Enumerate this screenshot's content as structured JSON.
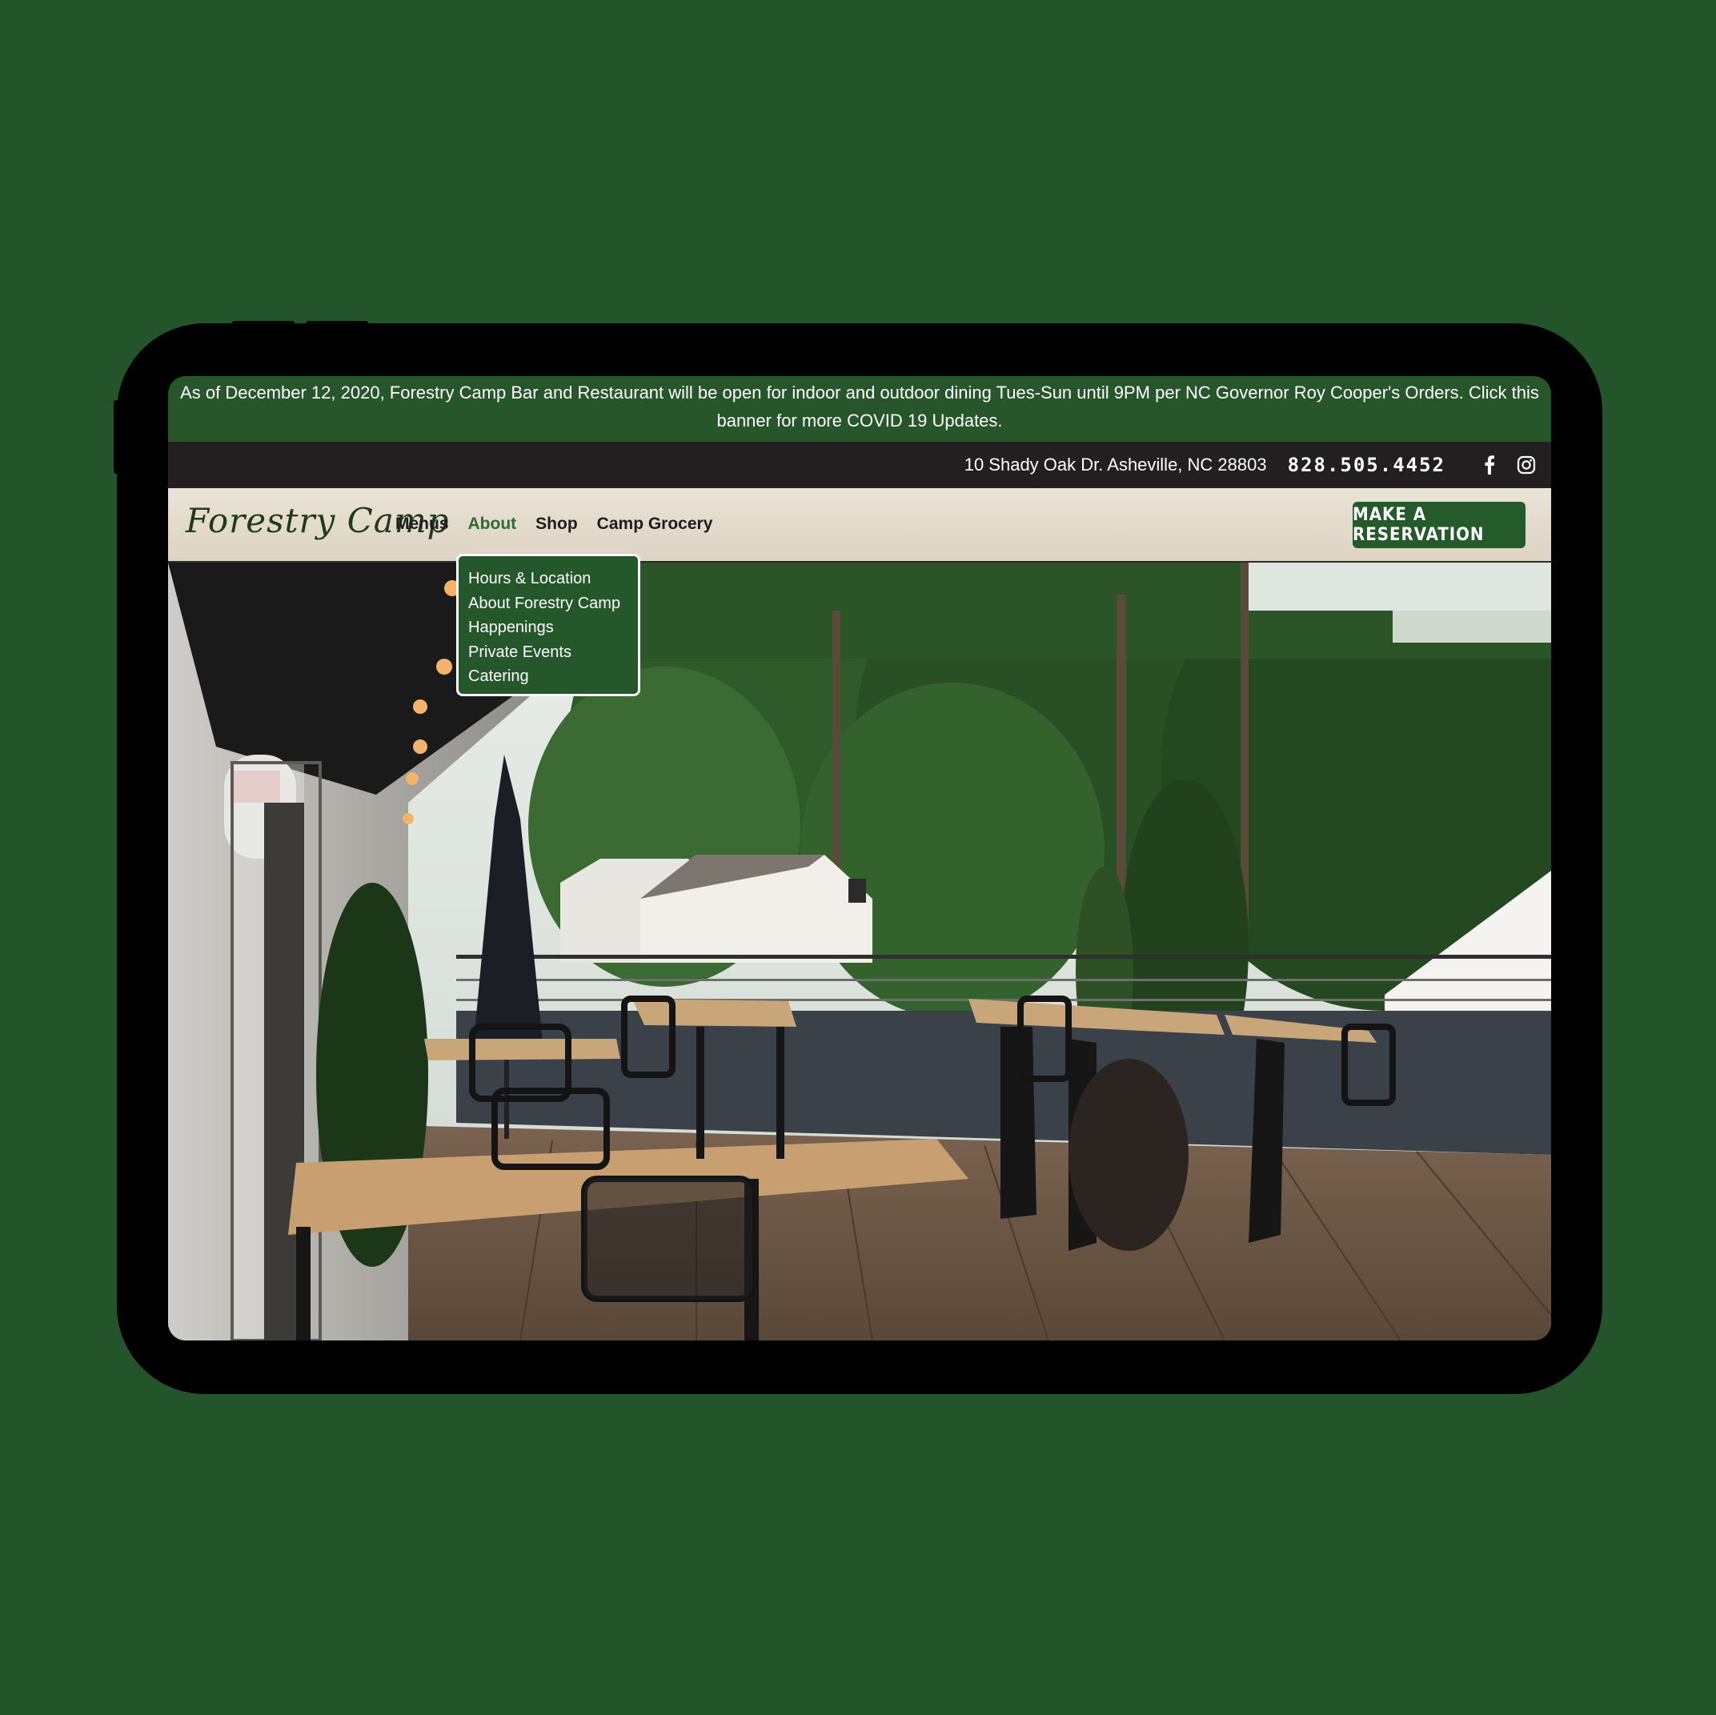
{
  "banner": {
    "text": "As of December 12, 2020, Forestry Camp Bar and Restaurant will be open for indoor and outdoor dining Tues-Sun until 9PM per NC Governor Roy Cooper's Orders. Click this banner for more COVID 19 Updates."
  },
  "topbar": {
    "address": "10 Shady Oak Dr. Asheville, NC 28803",
    "phone": "828.505.4452",
    "social": [
      {
        "icon": "facebook-icon"
      },
      {
        "icon": "instagram-icon"
      }
    ]
  },
  "navbar": {
    "logo": "Forestry Camp",
    "items": [
      {
        "label": "Menus"
      },
      {
        "label": "About"
      },
      {
        "label": "Shop"
      },
      {
        "label": "Camp Grocery"
      }
    ],
    "active_item": "About",
    "reserve_label": "MAKE A RESERVATION"
  },
  "dropdown": {
    "items": [
      {
        "label": "Hours & Location"
      },
      {
        "label": "About Forestry Camp"
      },
      {
        "label": "Happenings"
      },
      {
        "label": "Private Events"
      },
      {
        "label": "Catering"
      }
    ]
  },
  "colors": {
    "page_background": "#24552a",
    "brand_green": "#255a2a",
    "topbar": "#231f20",
    "navbar": "#e6dfd2"
  }
}
